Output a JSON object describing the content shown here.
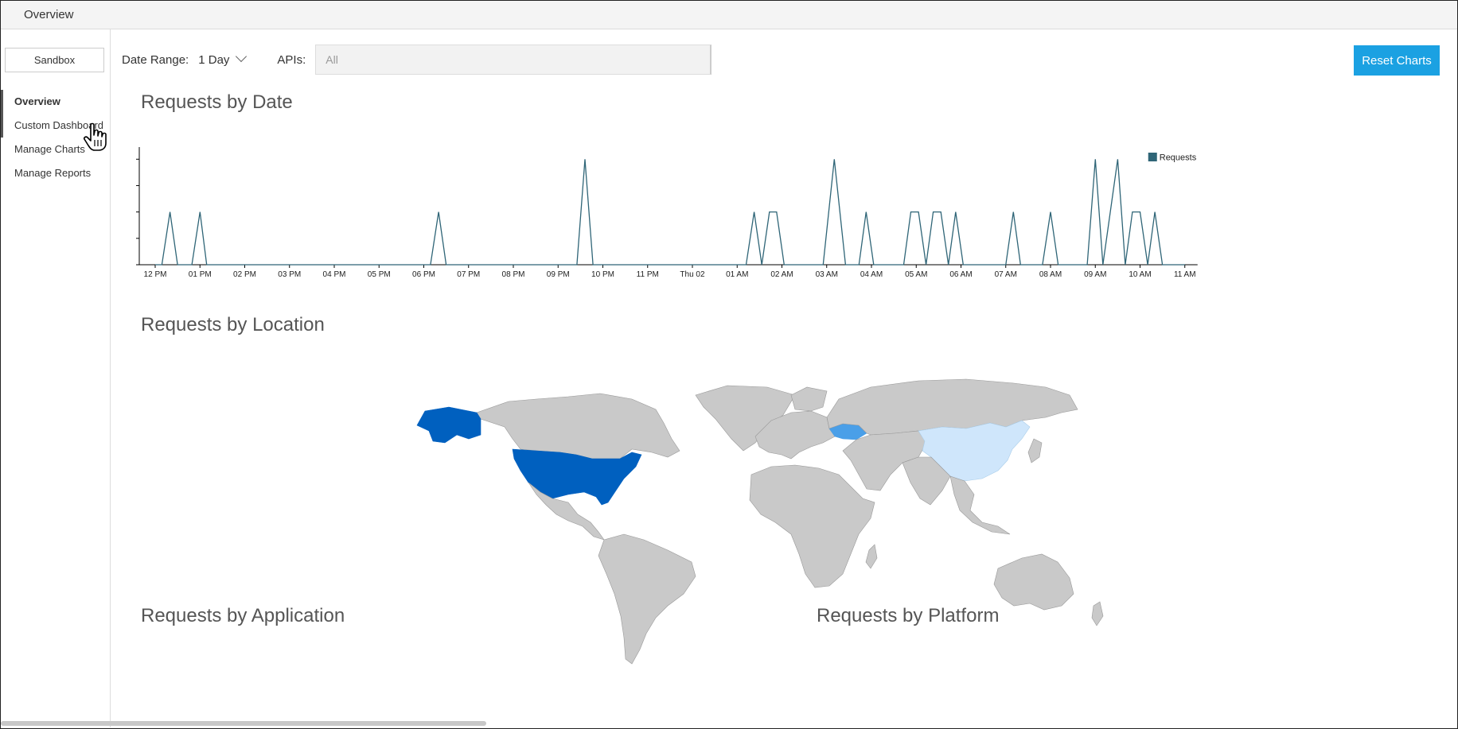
{
  "window": {
    "title": "Overview"
  },
  "sidebar": {
    "environment_button": "Sandbox",
    "items": [
      {
        "label": "Overview",
        "active": true
      },
      {
        "label": "Custom Dashboard",
        "active": false
      },
      {
        "label": "Manage Charts",
        "active": false
      },
      {
        "label": "Manage Reports",
        "active": false
      }
    ]
  },
  "filters": {
    "date_range_label": "Date Range:",
    "date_range_value": "1 Day",
    "apis_label": "APIs:",
    "apis_placeholder": "All"
  },
  "toolbar": {
    "reset_label": "Reset Charts"
  },
  "colors": {
    "accent": "#1ba1e2",
    "series": "#2f6577",
    "map_high": "#0060bf",
    "map_mid": "#4a9fe8",
    "map_low": "#cfe6fb",
    "map_none": "#c9c9c9"
  },
  "sections": {
    "requests_by_date": "Requests by Date",
    "requests_by_location": "Requests by Location",
    "requests_by_application": "Requests by Application",
    "requests_by_platform": "Requests by Platform"
  },
  "chart_data": {
    "type": "line",
    "title": "Requests by Date",
    "xlabel": "",
    "ylabel": "",
    "ylim": [
      0,
      2.2
    ],
    "yticks": [
      "0.0",
      "0.5",
      "1.0",
      "1.5",
      "2.0"
    ],
    "xticks": [
      "12 PM",
      "01 PM",
      "02 PM",
      "03 PM",
      "04 PM",
      "05 PM",
      "06 PM",
      "07 PM",
      "08 PM",
      "09 PM",
      "10 PM",
      "11 PM",
      "Thu 02",
      "01 AM",
      "02 AM",
      "03 AM",
      "04 AM",
      "05 AM",
      "06 AM",
      "07 AM",
      "08 AM",
      "09 AM",
      "10 AM",
      "11 AM"
    ],
    "legend": {
      "position": "top-right"
    },
    "series": [
      {
        "name": "Requests",
        "x": [
          0.0,
          0.15,
          0.33,
          0.5,
          0.82,
          1.0,
          1.15,
          1.33,
          1.5,
          6.15,
          6.33,
          6.5,
          9.42,
          9.6,
          9.78,
          13.2,
          13.38,
          13.55,
          13.72,
          13.88,
          14.05,
          14.22,
          14.92,
          15.17,
          15.42,
          15.72,
          15.88,
          16.05,
          16.72,
          16.88,
          17.05,
          17.22,
          17.38,
          17.55,
          17.72,
          17.88,
          18.05,
          18.22,
          18.38,
          19.0,
          19.17,
          19.33,
          19.82,
          20.0,
          20.17,
          20.82,
          21.0,
          21.17,
          21.5,
          21.67,
          21.83,
          22.0,
          22.17,
          22.33,
          22.5,
          22.67,
          22.83,
          23.0
        ],
        "y": [
          0,
          0,
          1,
          0,
          0,
          1,
          0,
          0,
          0,
          0,
          1,
          0,
          0,
          2,
          0,
          0,
          1,
          0,
          1,
          1,
          0,
          0,
          0,
          2,
          0,
          0,
          1,
          0,
          0,
          1,
          1,
          0,
          1,
          1,
          0,
          1,
          0,
          0,
          0,
          0,
          1,
          0,
          0,
          1,
          0,
          0,
          2,
          0,
          2,
          0,
          1,
          1,
          0,
          1,
          0,
          0,
          0,
          0
        ]
      }
    ]
  },
  "map_data": {
    "legend_note": "",
    "highlighted": [
      {
        "country": "United States",
        "level": "high"
      },
      {
        "country": "Alaska",
        "level": "high"
      },
      {
        "country": "Ukraine",
        "level": "mid"
      },
      {
        "country": "China",
        "level": "low"
      }
    ]
  }
}
